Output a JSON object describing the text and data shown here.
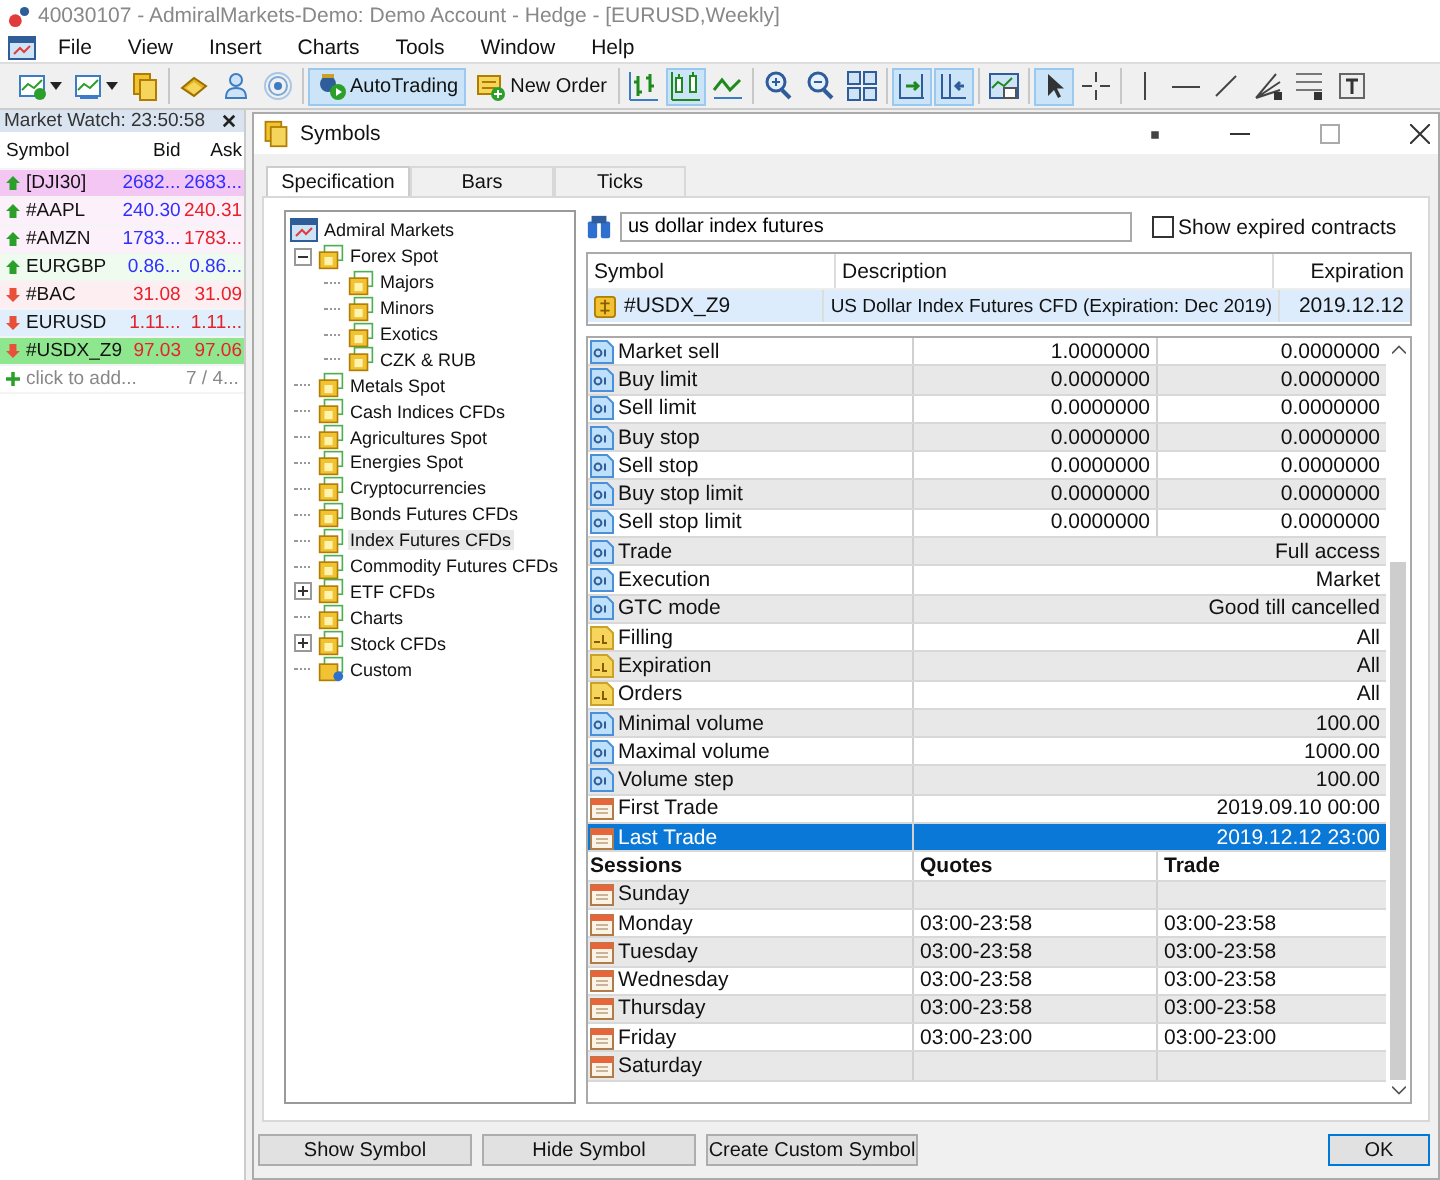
{
  "app_title": "40030107 - AdmiralMarkets-Demo: Demo Account - Hedge - [EURUSD,Weekly]",
  "menu": [
    "File",
    "View",
    "Insert",
    "Charts",
    "Tools",
    "Window",
    "Help"
  ],
  "toolbar": [
    {
      "items": [
        {
          "pressed": false,
          "dropdown": true
        },
        {
          "pressed": false,
          "dropdown": true
        },
        {
          "pressed": false
        }
      ]
    },
    {
      "items": [
        {
          "pressed": false
        },
        {
          "pressed": false
        },
        {
          "pressed": false
        }
      ]
    },
    {
      "items": [
        {
          "label": "AutoTrading",
          "pressed": true
        },
        {
          "label": "New Order",
          "pressed": false
        }
      ]
    },
    {
      "items": [
        {
          "pressed": false
        },
        {
          "pressed": true
        },
        {
          "pressed": false
        }
      ]
    },
    {
      "items": [
        {
          "pressed": false
        },
        {
          "pressed": false
        },
        {
          "pressed": false
        }
      ]
    },
    {
      "items": [
        {
          "pressed": true
        },
        {
          "pressed": true
        }
      ]
    },
    {
      "items": [
        {
          "pressed": false
        }
      ]
    },
    {
      "items": [
        {
          "pressed": true
        },
        {
          "pressed": false
        }
      ]
    },
    {
      "items": [
        {
          "pressed": false
        },
        {
          "pressed": false
        },
        {
          "pressed": false
        },
        {
          "pressed": false
        },
        {
          "pressed": false
        },
        {
          "pressed": false
        }
      ]
    }
  ],
  "market_watch": {
    "title": "Market Watch: 23:50:58",
    "columns": [
      "Symbol",
      "Bid",
      "Ask"
    ],
    "rows": [
      {
        "symbol": "[DJI30]",
        "bid": "2682...",
        "ask": "2683...",
        "rising": true,
        "bid_up": true,
        "ask_up": true,
        "color": "#f3c6f3"
      },
      {
        "symbol": "#AAPL",
        "bid": "240.30",
        "ask": "240.31",
        "rising": true,
        "bid_up": true,
        "ask_up": false,
        "color": "#fcf0fa"
      },
      {
        "symbol": "#AMZN",
        "bid": "1783...",
        "ask": "1783...",
        "rising": true,
        "bid_up": true,
        "ask_up": false,
        "color": "#fcf0fa"
      },
      {
        "symbol": "EURGBP",
        "bid": "0.86...",
        "ask": "0.86...",
        "rising": true,
        "bid_up": true,
        "ask_up": true,
        "color": "#eefbee"
      },
      {
        "symbol": "#BAC",
        "bid": "31.08",
        "ask": "31.09",
        "rising": false,
        "bid_up": false,
        "ask_up": false,
        "color": "#fdeef1"
      },
      {
        "symbol": "EURUSD",
        "bid": "1.11...",
        "ask": "1.11...",
        "rising": false,
        "bid_up": false,
        "ask_up": false,
        "color": "#e1eefb"
      },
      {
        "symbol": "#USDX_Z9",
        "bid": "97.03",
        "ask": "97.06",
        "rising": false,
        "bid_up": false,
        "ask_up": false,
        "color": "#8ee68e"
      }
    ],
    "add_label": "click to add...",
    "count": "7 / 4..."
  },
  "dialog": {
    "title": "Symbols",
    "tabs": [
      {
        "label": "Specification",
        "selected": true
      },
      {
        "label": "Bars",
        "selected": false
      },
      {
        "label": "Ticks",
        "selected": false
      }
    ],
    "tree": {
      "label": "Admiral Markets",
      "children": [
        {
          "label": "Forex Spot",
          "kind": "folder",
          "expanded": true,
          "selected": false,
          "children": [
            {
              "label": "Majors",
              "kind": "folder",
              "selected": false
            },
            {
              "label": "Minors",
              "kind": "folder",
              "selected": false
            },
            {
              "label": "Exotics",
              "kind": "folder",
              "selected": false
            },
            {
              "label": "CZK & RUB",
              "kind": "folder",
              "selected": false
            }
          ]
        },
        {
          "label": "Metals Spot",
          "kind": "folder",
          "selected": false
        },
        {
          "label": "Cash Indices CFDs",
          "kind": "folder",
          "selected": false
        },
        {
          "label": "Agricultures Spot",
          "kind": "folder",
          "selected": false
        },
        {
          "label": "Energies Spot",
          "kind": "folder",
          "selected": false
        },
        {
          "label": "Cryptocurrencies",
          "kind": "folder",
          "selected": false
        },
        {
          "label": "Bonds Futures CFDs",
          "kind": "folder",
          "selected": false
        },
        {
          "label": "Index Futures CFDs",
          "kind": "folder",
          "selected": true
        },
        {
          "label": "Commodity Futures CFDs",
          "kind": "folder",
          "selected": false
        },
        {
          "label": "ETF CFDs",
          "kind": "folder",
          "expanded": false,
          "selected": false
        },
        {
          "label": "Charts",
          "kind": "folder",
          "selected": false
        },
        {
          "label": "Stock CFDs",
          "kind": "folder",
          "expanded": false,
          "selected": false
        },
        {
          "label": "Custom",
          "kind": "custom",
          "selected": false
        }
      ]
    },
    "search": {
      "value": "us dollar index futures"
    },
    "show_expired": {
      "label": "Show expired contracts",
      "checked": false
    },
    "symbols": {
      "columns": [
        "Symbol",
        "Description",
        "Expiration"
      ],
      "rows": [
        {
          "symbol": "#USDX_Z9",
          "description": "US Dollar Index Futures CFD (Expiration: Dec 2019)",
          "expiration": "2019.12.12",
          "selected": true
        }
      ]
    },
    "properties": [
      {
        "kind": "numeric",
        "label": "Market sell",
        "values": [
          "1.0000000",
          "0.0000000"
        ],
        "selected": false
      },
      {
        "kind": "numeric",
        "label": "Buy limit",
        "values": [
          "0.0000000",
          "0.0000000"
        ],
        "selected": false
      },
      {
        "kind": "numeric",
        "label": "Sell limit",
        "values": [
          "0.0000000",
          "0.0000000"
        ],
        "selected": false
      },
      {
        "kind": "numeric",
        "label": "Buy stop",
        "values": [
          "0.0000000",
          "0.0000000"
        ],
        "selected": false
      },
      {
        "kind": "numeric",
        "label": "Sell stop",
        "values": [
          "0.0000000",
          "0.0000000"
        ],
        "selected": false
      },
      {
        "kind": "numeric",
        "label": "Buy stop limit",
        "values": [
          "0.0000000",
          "0.0000000"
        ],
        "selected": false
      },
      {
        "kind": "numeric",
        "label": "Sell stop limit",
        "values": [
          "0.0000000",
          "0.0000000"
        ],
        "selected": false
      },
      {
        "kind": "numeric",
        "label": "Trade",
        "values": [
          "Full access"
        ],
        "selected": false
      },
      {
        "kind": "numeric",
        "label": "Execution",
        "values": [
          "Market"
        ],
        "selected": false
      },
      {
        "kind": "numeric",
        "label": "GTC mode",
        "values": [
          "Good till cancelled"
        ],
        "selected": false
      },
      {
        "kind": "text",
        "label": "Filling",
        "values": [
          "All"
        ],
        "selected": false
      },
      {
        "kind": "text",
        "label": "Expiration",
        "values": [
          "All"
        ],
        "selected": false
      },
      {
        "kind": "text",
        "label": "Orders",
        "values": [
          "All"
        ],
        "selected": false
      },
      {
        "kind": "numeric",
        "label": "Minimal volume",
        "values": [
          "100.00"
        ],
        "selected": false
      },
      {
        "kind": "numeric",
        "label": "Maximal volume",
        "values": [
          "1000.00"
        ],
        "selected": false
      },
      {
        "kind": "numeric",
        "label": "Volume step",
        "values": [
          "100.00"
        ],
        "selected": false
      },
      {
        "kind": "date",
        "label": "First Trade",
        "values": [
          "2019.09.10 00:00"
        ],
        "selected": false
      },
      {
        "kind": "date",
        "label": "Last Trade",
        "values": [
          "2019.12.12 23:00"
        ],
        "selected": true
      }
    ],
    "sessions": {
      "columns": [
        "Sessions",
        "Quotes",
        "Trade"
      ],
      "days": [
        {
          "label": "Sunday"
        },
        {
          "label": "Monday",
          "quotes": "03:00-23:58",
          "trade": "03:00-23:58"
        },
        {
          "label": "Tuesday",
          "quotes": "03:00-23:58",
          "trade": "03:00-23:58"
        },
        {
          "label": "Wednesday",
          "quotes": "03:00-23:58",
          "trade": "03:00-23:58"
        },
        {
          "label": "Thursday",
          "quotes": "03:00-23:58",
          "trade": "03:00-23:58"
        },
        {
          "label": "Friday",
          "quotes": "03:00-23:00",
          "trade": "03:00-23:00"
        },
        {
          "label": "Saturday"
        }
      ]
    },
    "buttons": [
      {
        "label": "Show Symbol"
      },
      {
        "label": "Hide Symbol"
      },
      {
        "label": "Create Custom Symbol"
      }
    ],
    "ok_button": "OK"
  }
}
